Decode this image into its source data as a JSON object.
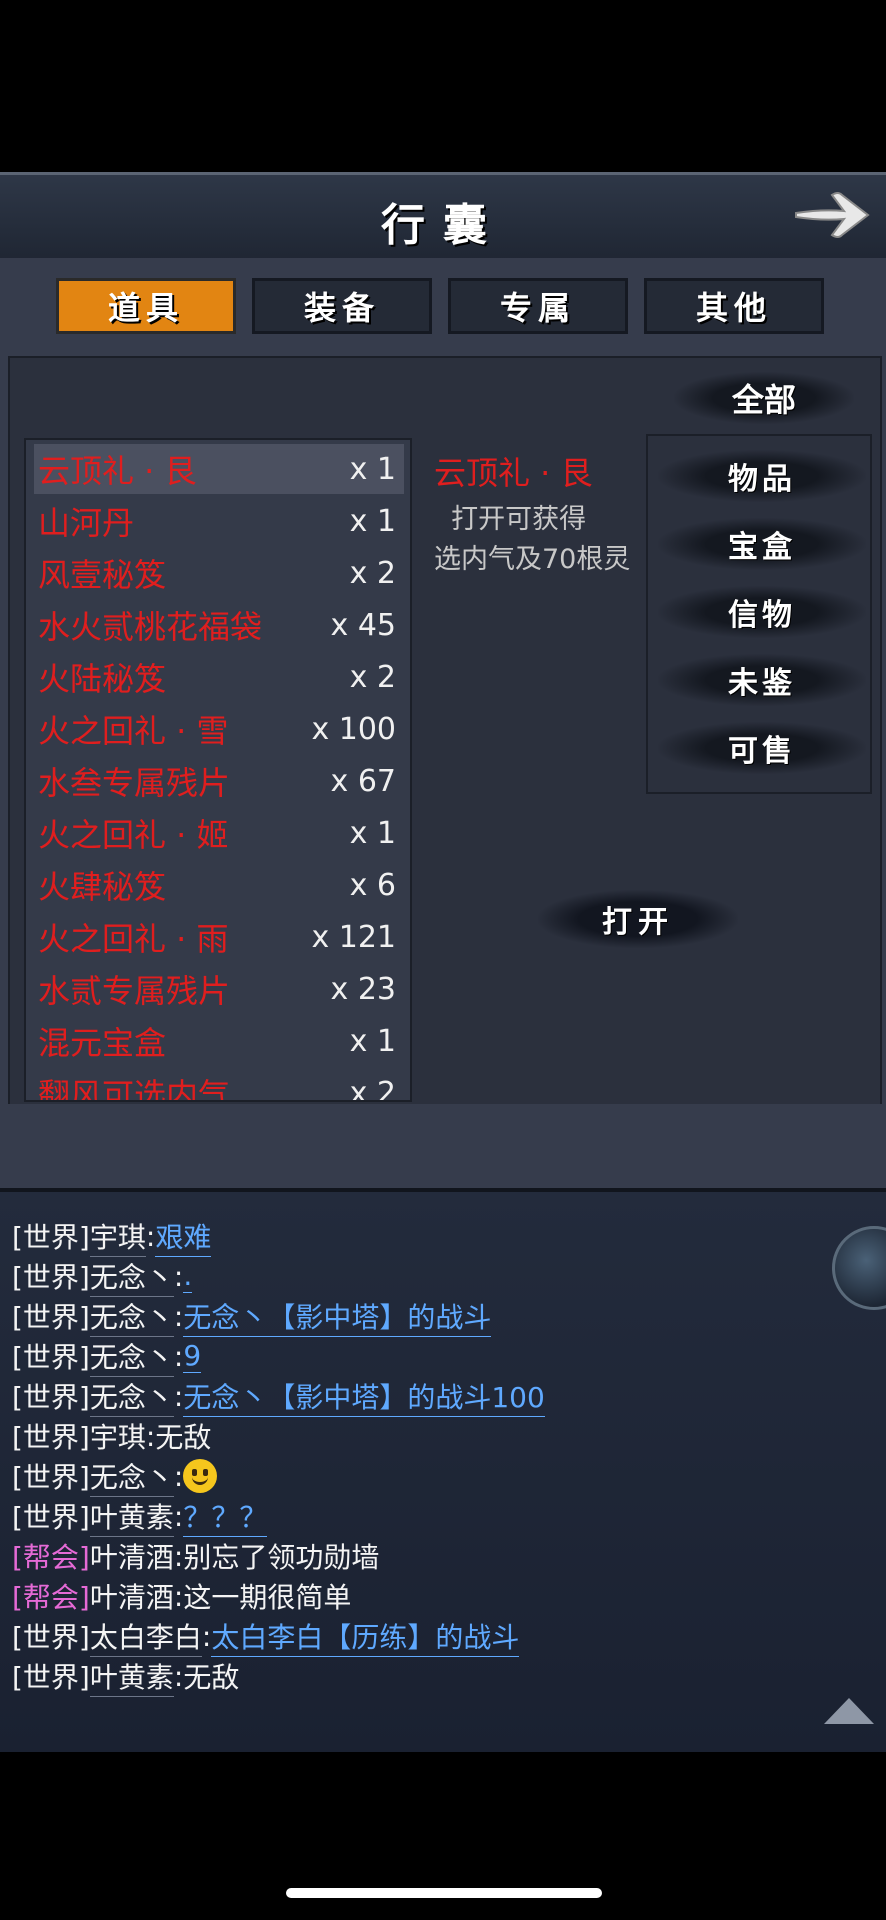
{
  "header": {
    "title": "行囊",
    "back_icon": "arrow-right-icon"
  },
  "tabs": [
    {
      "label": "道具",
      "active": true
    },
    {
      "label": "装备",
      "active": false
    },
    {
      "label": "专属",
      "active": false
    },
    {
      "label": "其他",
      "active": false
    }
  ],
  "filter_all": "全部",
  "items": [
    {
      "name": "云顶礼 · 艮",
      "qty": "x 1",
      "selected": true
    },
    {
      "name": "山河丹",
      "qty": "x 1"
    },
    {
      "name": "风壹秘笈",
      "qty": "x 2"
    },
    {
      "name": "水火贰桃花福袋",
      "qty": "x 45"
    },
    {
      "name": "火陆秘笈",
      "qty": "x 2"
    },
    {
      "name": "火之回礼 · 雪",
      "qty": "x 100"
    },
    {
      "name": "水叁专属残片",
      "qty": "x 67"
    },
    {
      "name": "火之回礼 · 姬",
      "qty": "x 1"
    },
    {
      "name": "火肆秘笈",
      "qty": "x 6"
    },
    {
      "name": "火之回礼 · 雨",
      "qty": "x 121"
    },
    {
      "name": "水贰专属残片",
      "qty": "x 23"
    },
    {
      "name": "混元宝盒",
      "qty": "x 1"
    },
    {
      "name": "翻风可选内气",
      "qty": "x 2"
    }
  ],
  "detail": {
    "name": "云顶礼 · 艮",
    "description": "  打开可获得\n选内气及70根灵"
  },
  "categories": [
    "物品",
    "宝盒",
    "信物",
    "未鉴",
    "可售"
  ],
  "open_button": "打开",
  "chat": [
    {
      "channel": "[世界]",
      "type": "world",
      "sender": "宇琪",
      "message": "艰难",
      "link": true
    },
    {
      "channel": "[世界]",
      "type": "world",
      "sender": "无念丶",
      "message": ".",
      "link": true
    },
    {
      "channel": "[世界]",
      "type": "world",
      "sender": "无念丶",
      "message": "无念丶【影中塔】的战斗",
      "link": true
    },
    {
      "channel": "[世界]",
      "type": "world",
      "sender": "无念丶",
      "message": "9",
      "link": true
    },
    {
      "channel": "[世界]",
      "type": "world",
      "sender": "无念丶",
      "message": "无念丶【影中塔】的战斗100",
      "link": true
    },
    {
      "channel": "[世界]",
      "type": "world",
      "sender": "宇琪",
      "message": "无敌",
      "link": false
    },
    {
      "channel": "[世界]",
      "type": "world",
      "sender": "无念丶",
      "message": "",
      "emoji": "smiling-face-icon",
      "link": false
    },
    {
      "channel": "[世界]",
      "type": "world",
      "sender": "叶黄素",
      "message": "？？？",
      "link": true
    },
    {
      "channel": "[帮会]",
      "type": "guild",
      "sender": "叶清酒",
      "message": "别忘了领功勋墙",
      "link": false
    },
    {
      "channel": "[帮会]",
      "type": "guild",
      "sender": "叶清酒",
      "message": "这一期很简单",
      "link": false
    },
    {
      "channel": "[世界]",
      "type": "world",
      "sender": "太白李白",
      "message": "太白李白【历练】的战斗",
      "link": true
    },
    {
      "channel": "[世界]",
      "type": "world",
      "sender": "叶黄素",
      "message": "无敌",
      "link": false
    }
  ],
  "colors": {
    "tab_active": "#e28512",
    "item_name": "#e01e1e",
    "link": "#5fa9ff",
    "guild_channel": "#e56ad6"
  }
}
